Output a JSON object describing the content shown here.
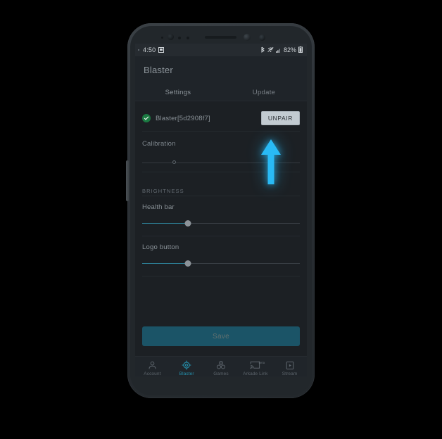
{
  "status_bar": {
    "time": "4:50",
    "notification_icon": "screenshot-image-icon",
    "battery_percent": "82%",
    "icons": [
      "bluetooth-icon",
      "wifi-off-icon",
      "cellular-signal-icon",
      "battery-icon"
    ]
  },
  "app_bar": {
    "title": "Blaster"
  },
  "tabs": [
    {
      "label": "Settings",
      "active": true
    },
    {
      "label": "Update",
      "active": false
    }
  ],
  "device": {
    "status_icon": "green-check-icon",
    "name": "Blaster[5d2908f7]",
    "unpair_label": "UNPAIR"
  },
  "calibration": {
    "label": "Calibration",
    "thumb_percent": 19
  },
  "brightness": {
    "header": "BRIGHTNESS",
    "sliders": [
      {
        "label": "Health bar",
        "value_percent": 29
      },
      {
        "label": "Logo button",
        "value_percent": 29
      }
    ]
  },
  "actions": {
    "save_label": "Save"
  },
  "bottom_nav": [
    {
      "label": "Account",
      "icon": "person-icon",
      "active": false,
      "badge": ""
    },
    {
      "label": "Blaster",
      "icon": "crosshair-icon",
      "active": true,
      "badge": ""
    },
    {
      "label": "Games",
      "icon": "game-dots-icon",
      "active": false,
      "badge": ""
    },
    {
      "label": "Arkade Link",
      "icon": "cast-screen-icon",
      "active": false,
      "badge": "beta"
    },
    {
      "label": "Stream",
      "icon": "stream-play-icon",
      "active": false,
      "badge": ""
    }
  ],
  "system_nav": {
    "buttons": [
      {
        "name": "screenshot-capture-icon",
        "glyph": ""
      },
      {
        "name": "back-icon",
        "glyph": "‹"
      },
      {
        "name": "home-icon",
        "glyph": ""
      },
      {
        "name": "recents-icon",
        "glyph": "|||"
      },
      {
        "name": "multiwindow-icon",
        "glyph": ""
      }
    ]
  },
  "annotation": {
    "type": "up-arrow",
    "color": "#29baf5",
    "points_at": "UNPAIR"
  },
  "colors": {
    "accent_cyan": "#29baf5",
    "tab_indicator": "#1d7f93",
    "slider_fill": "#2d7e95",
    "save_bg": "#1b5467",
    "device_ok_green": "#1b7a42",
    "unpair_bg": "#c2cbd1",
    "screen_bg": "#1c2024"
  }
}
